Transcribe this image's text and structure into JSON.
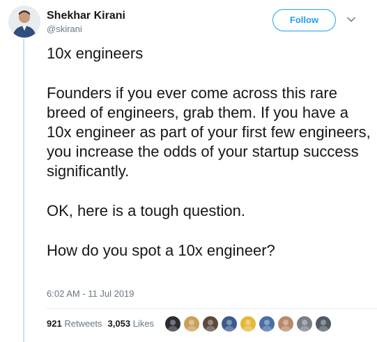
{
  "author": {
    "name": "Shekhar Kirani",
    "handle": "@skirani"
  },
  "follow_label": "Follow",
  "tweet": {
    "paragraphs": [
      "10x engineers",
      "Founders if you ever come across this rare breed of engineers, grab them. If you have a 10x engineer as part of your first few engineers, you increase the odds of your startup success significantly.",
      "OK, here is a tough question.",
      "How do you spot a 10x engineer?"
    ],
    "timestamp": "6:02 AM - 11 Jul 2019"
  },
  "stats": {
    "retweets_count": "921",
    "retweets_label": "Retweets",
    "likes_count": "3,053",
    "likes_label": "Likes"
  },
  "colors": {
    "accent": "#1da1f2",
    "thread_line": "#c4e2f6",
    "secondary_text": "#657786"
  },
  "liker_avatars": [
    {
      "color": "#2a2d33"
    },
    {
      "color": "#c9a05a"
    },
    {
      "color": "#5b4a3c"
    },
    {
      "color": "#3b5b8c"
    },
    {
      "color": "#e3b83b"
    },
    {
      "color": "#4a6fa5"
    },
    {
      "color": "#b88a6a"
    },
    {
      "color": "#7a7f87"
    },
    {
      "color": "#4f5a66"
    }
  ]
}
